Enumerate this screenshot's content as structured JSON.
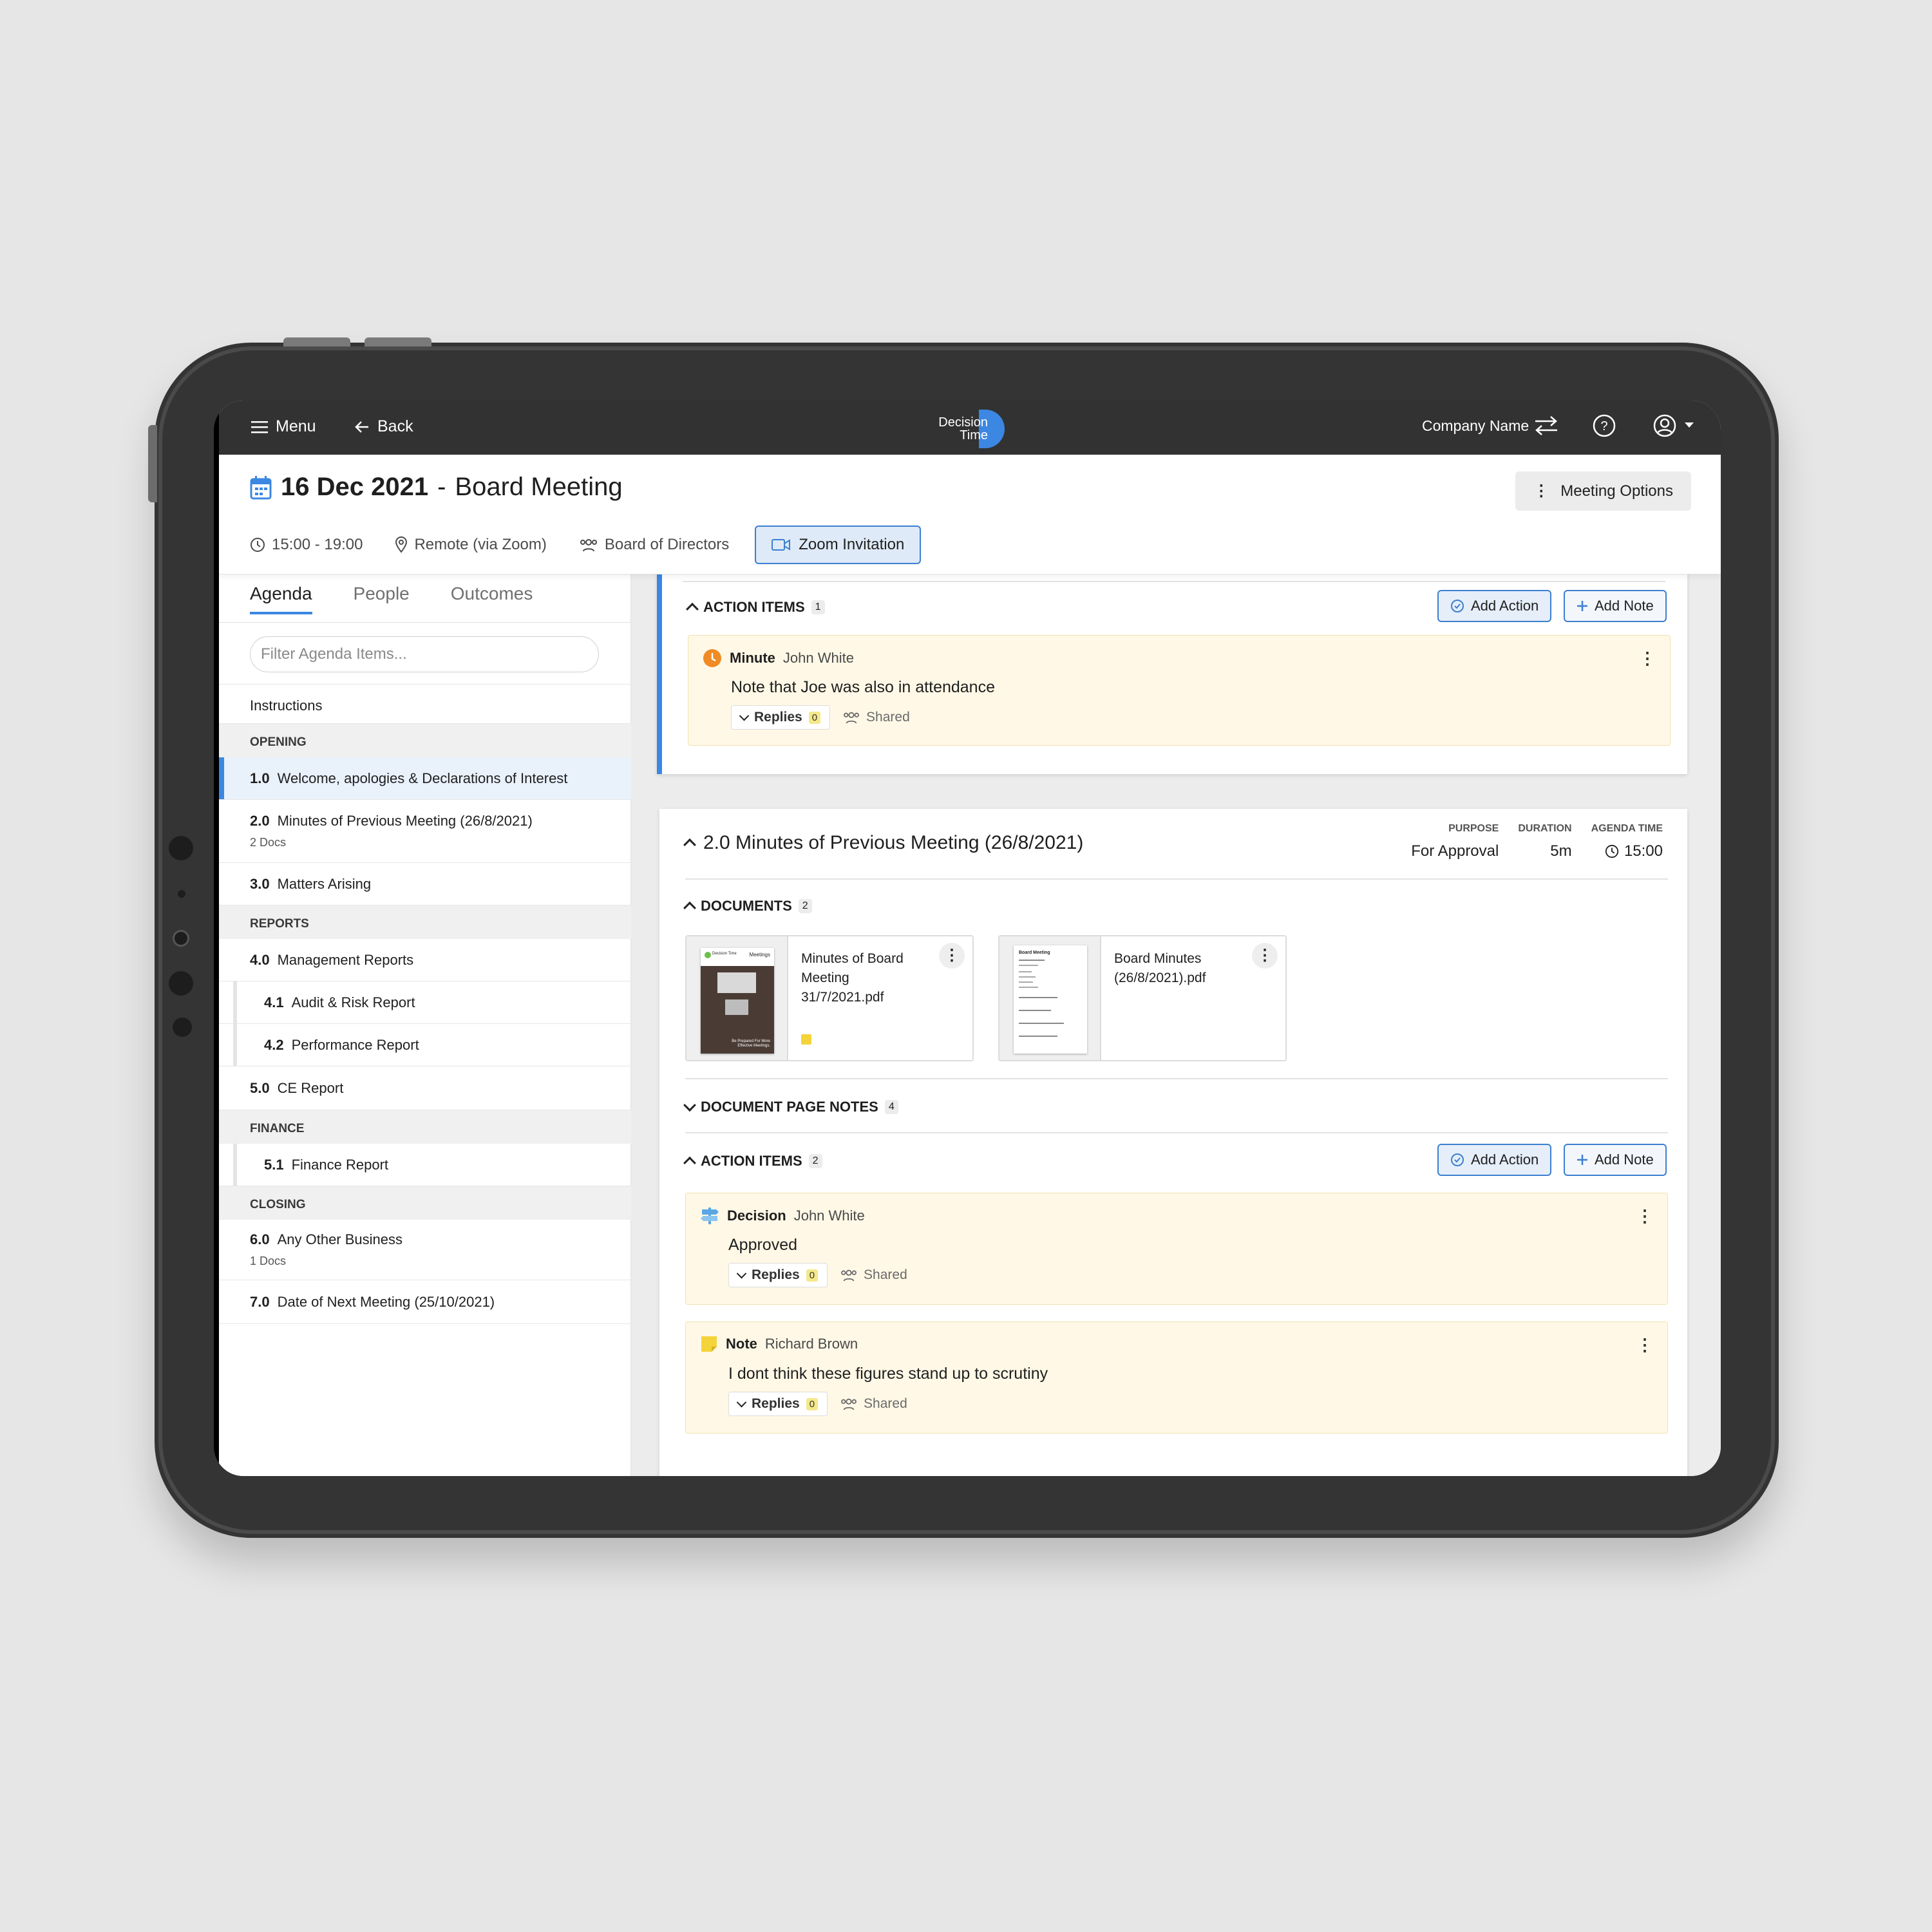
{
  "nav": {
    "menu_label": "Menu",
    "back_label": "Back",
    "logo_line1": "Decision",
    "logo_line2": "Time",
    "company_name": "Company Name"
  },
  "meeting": {
    "date": "16 Dec 2021",
    "separator": "-",
    "name": "Board Meeting",
    "time": "15:00 - 19:00",
    "location": "Remote (via Zoom)",
    "group": "Board of Directors",
    "zoom_label": "Zoom Invitation",
    "options_label": "Meeting Options"
  },
  "sidebar": {
    "tabs": [
      "Agenda",
      "People",
      "Outcomes"
    ],
    "filter_placeholder": "Filter Agenda Items...",
    "instructions": "Instructions",
    "sections": {
      "opening": "OPENING",
      "reports": "REPORTS",
      "finance": "FINANCE",
      "closing": "CLOSING"
    },
    "items": [
      {
        "num": "1.0",
        "label": "Welcome, apologies & Declarations of Interest",
        "docs": ""
      },
      {
        "num": "2.0",
        "label": "Minutes of Previous Meeting (26/8/2021)",
        "docs": "2 Docs"
      },
      {
        "num": "3.0",
        "label": "Matters Arising",
        "docs": ""
      },
      {
        "num": "4.0",
        "label": "Management Reports",
        "docs": ""
      },
      {
        "num": "4.1",
        "label": "Audit & Risk Report",
        "docs": ""
      },
      {
        "num": "4.2",
        "label": "Performance Report",
        "docs": ""
      },
      {
        "num": "5.0",
        "label": "CE Report",
        "docs": ""
      },
      {
        "num": "5.1",
        "label": "Finance Report",
        "docs": ""
      },
      {
        "num": "6.0",
        "label": "Any Other Business",
        "docs": "1 Docs"
      },
      {
        "num": "7.0",
        "label": "Date of Next Meeting (25/10/2021)",
        "docs": ""
      }
    ]
  },
  "card1": {
    "action_items_label": "ACTION ITEMS",
    "action_items_count": "1",
    "add_action_label": "Add Action",
    "add_note_label": "Add Note",
    "note": {
      "type": "Minute",
      "author": "John White",
      "text": "Note that Joe was also in attendance",
      "replies_label": "Replies",
      "replies_count": "0",
      "shared_label": "Shared"
    }
  },
  "card2": {
    "title": "2.0 Minutes of Previous Meeting (26/8/2021)",
    "purpose_label": "PURPOSE",
    "purpose_value": "For Approval",
    "duration_label": "DURATION",
    "duration_value": "5m",
    "agenda_time_label": "AGENDA TIME",
    "agenda_time_value": "15:00",
    "documents_label": "DOCUMENTS",
    "documents_count": "2",
    "documents": [
      {
        "name": "Minutes of Board Meeting 31/7/2021.pdf",
        "thumb_title": "Meetings",
        "thumb_brand": "Decision Time",
        "thumb_tagline": "Be Prepared For More Effective Meetings."
      },
      {
        "name": "Board Minutes (26/8/2021).pdf",
        "thumb_title": "Board Meeting"
      }
    ],
    "page_notes_label": "DOCUMENT PAGE NOTES",
    "page_notes_count": "4",
    "action_items_label": "ACTION ITEMS",
    "action_items_count": "2",
    "add_action_label": "Add Action",
    "add_note_label": "Add Note",
    "notes": [
      {
        "type": "Decision",
        "author": "John White",
        "text": "Approved",
        "replies_label": "Replies",
        "replies_count": "0",
        "shared_label": "Shared"
      },
      {
        "type": "Note",
        "author": "Richard Brown",
        "text": "I dont think these figures stand up to scrutiny",
        "replies_label": "Replies",
        "replies_count": "0",
        "shared_label": "Shared"
      }
    ]
  },
  "colors": {
    "accent": "#3b87e2",
    "nav_bg": "#323232",
    "note_bg": "#fff8e6",
    "minute_icon": "#f08a24",
    "decision_icon": "#5aa6e6",
    "note_icon": "#f5d33a"
  }
}
